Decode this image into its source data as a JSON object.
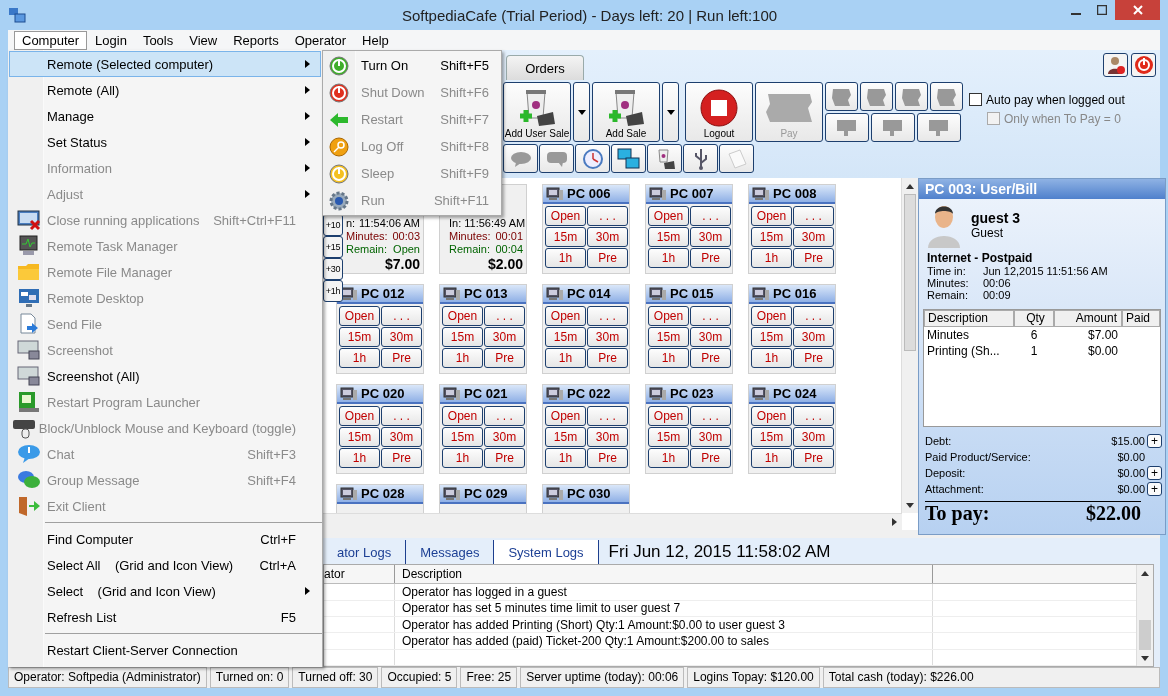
{
  "window": {
    "title": "SoftpediaCafe (Trial Period) - Days left: 20 | Run left:100"
  },
  "menu_bar": [
    {
      "label": "Computer",
      "selected": true
    },
    {
      "label": "Login",
      "selected": false
    },
    {
      "label": "Tools",
      "selected": false
    },
    {
      "label": "View",
      "selected": false
    },
    {
      "label": "Reports",
      "selected": false
    },
    {
      "label": "Operator",
      "selected": false
    },
    {
      "label": "Help",
      "selected": false
    }
  ],
  "computer_menu": [
    {
      "kind": "item",
      "label": "Remote (Selected computer)",
      "submenu": true,
      "disabled": false,
      "selected": true
    },
    {
      "kind": "item",
      "label": "Remote (All)",
      "submenu": true,
      "disabled": false,
      "selected": false
    },
    {
      "kind": "item",
      "label": "Manage",
      "submenu": true,
      "disabled": false,
      "selected": false
    },
    {
      "kind": "item",
      "label": "Set Status",
      "submenu": true,
      "disabled": false,
      "selected": false
    },
    {
      "kind": "item",
      "label": "Information",
      "submenu": true,
      "disabled": true,
      "selected": false
    },
    {
      "kind": "item",
      "label": "Adjust",
      "submenu": true,
      "disabled": true,
      "selected": false
    },
    {
      "kind": "item",
      "label": "Close running applications",
      "shortcut": "Shift+Ctrl+F11",
      "submenu": false,
      "disabled": true,
      "selected": false
    },
    {
      "kind": "item",
      "label": "Remote Task Manager",
      "submenu": false,
      "disabled": true,
      "selected": false
    },
    {
      "kind": "item",
      "label": "Remote File Manager",
      "submenu": false,
      "disabled": true,
      "selected": false
    },
    {
      "kind": "item",
      "label": "Remote Desktop",
      "submenu": false,
      "disabled": true,
      "selected": false
    },
    {
      "kind": "item",
      "label": "Send File",
      "submenu": false,
      "disabled": true,
      "selected": false
    },
    {
      "kind": "item",
      "label": "Screenshot",
      "submenu": false,
      "disabled": true,
      "selected": false
    },
    {
      "kind": "item",
      "label": "Screenshot (All)",
      "submenu": false,
      "disabled": false,
      "selected": false
    },
    {
      "kind": "item",
      "label": "Restart Program Launcher",
      "submenu": false,
      "disabled": true,
      "selected": false
    },
    {
      "kind": "item",
      "label": "Block/Unblock Mouse and Keyboard (toggle)",
      "submenu": false,
      "disabled": true,
      "selected": false
    },
    {
      "kind": "item",
      "label": "Chat",
      "shortcut": "Shift+F3",
      "submenu": false,
      "disabled": true,
      "selected": false
    },
    {
      "kind": "item",
      "label": "Group Message",
      "shortcut": "Shift+F4",
      "submenu": false,
      "disabled": true,
      "selected": false
    },
    {
      "kind": "item",
      "label": "Exit Client",
      "submenu": false,
      "disabled": true,
      "selected": false
    },
    {
      "kind": "separator"
    },
    {
      "kind": "item",
      "label": "Find Computer",
      "shortcut": "Ctrl+F",
      "submenu": false,
      "disabled": false,
      "selected": false
    },
    {
      "kind": "item",
      "label": "Select All    (Grid and Icon View)",
      "shortcut": "Ctrl+A",
      "submenu": false,
      "disabled": false,
      "selected": false
    },
    {
      "kind": "item",
      "label": "Select    (Grid and Icon View)",
      "submenu": true,
      "disabled": false,
      "selected": false
    },
    {
      "kind": "item",
      "label": "Refresh List",
      "shortcut": "F5",
      "submenu": false,
      "disabled": false,
      "selected": false
    },
    {
      "kind": "separator"
    },
    {
      "kind": "item",
      "label": "Restart Client-Server Connection",
      "submenu": false,
      "disabled": false,
      "selected": false
    }
  ],
  "remote_submenu": [
    {
      "label": "Turn On",
      "shortcut": "Shift+F5",
      "disabled": false
    },
    {
      "label": "Shut Down",
      "shortcut": "Shift+F6",
      "disabled": true
    },
    {
      "label": "Restart",
      "shortcut": "Shift+F7",
      "disabled": true
    },
    {
      "label": "Log Off",
      "shortcut": "Shift+F8",
      "disabled": true
    },
    {
      "label": "Sleep",
      "shortcut": "Shift+F9",
      "disabled": true
    },
    {
      "label": "Run",
      "shortcut": "Shift+F11",
      "disabled": true
    }
  ],
  "tabs": [
    {
      "label": "Orders"
    }
  ],
  "toolbar": [
    {
      "label": "Add User Sale",
      "dropdown": true,
      "disabled": false
    },
    {
      "label": "Add Sale",
      "dropdown": true,
      "disabled": false
    },
    {
      "label": "Logout",
      "dropdown": false,
      "disabled": false
    },
    {
      "label": "Pay",
      "dropdown": false,
      "disabled": true
    }
  ],
  "options": [
    {
      "label": "Auto pay when logged out",
      "checked": false,
      "disabled": false
    },
    {
      "label": "Only when To Pay = 0",
      "checked": false,
      "disabled": true
    }
  ],
  "pc_grid": {
    "time_buttons": [
      "+10",
      "+15",
      "+30",
      "+1h"
    ],
    "rows": [
      [
        {
          "kind": "session",
          "lines": [
            {
              "label": "n:",
              "value": "11:54:06 AM"
            },
            {
              "label": "Minutes:",
              "value": "00:03"
            },
            {
              "label": "Remain:",
              "value": "Open"
            }
          ],
          "amount": "$7.00"
        },
        {
          "kind": "session",
          "lines": [
            {
              "label": "In:",
              "value": "11:56:49 AM"
            },
            {
              "label": "Minutes:",
              "value": "00:01"
            },
            {
              "label": "Remain:",
              "value": "00:04"
            }
          ],
          "amount": "$2.00"
        },
        {
          "kind": "free",
          "name": "PC 006",
          "buttons": [
            "Open",
            ". . .",
            "15m",
            "30m",
            "1h",
            "Pre"
          ]
        },
        {
          "kind": "free",
          "name": "PC 007",
          "buttons": [
            "Open",
            ". . .",
            "15m",
            "30m",
            "1h",
            "Pre"
          ]
        },
        {
          "kind": "free",
          "name": "PC 008",
          "buttons": [
            "Open",
            ". . .",
            "15m",
            "30m",
            "1h",
            "Pre"
          ]
        }
      ],
      [
        {
          "kind": "free",
          "name": "PC 012",
          "buttons": [
            "Open",
            ". . .",
            "15m",
            "30m",
            "1h",
            "Pre"
          ]
        },
        {
          "kind": "free",
          "name": "PC 013",
          "buttons": [
            "Open",
            ". . .",
            "15m",
            "30m",
            "1h",
            "Pre"
          ]
        },
        {
          "kind": "free",
          "name": "PC 014",
          "buttons": [
            "Open",
            ". . .",
            "15m",
            "30m",
            "1h",
            "Pre"
          ]
        },
        {
          "kind": "free",
          "name": "PC 015",
          "buttons": [
            "Open",
            ". . .",
            "15m",
            "30m",
            "1h",
            "Pre"
          ]
        },
        {
          "kind": "free",
          "name": "PC 016",
          "buttons": [
            "Open",
            ". . .",
            "15m",
            "30m",
            "1h",
            "Pre"
          ]
        }
      ],
      [
        {
          "kind": "free",
          "name": "PC 020",
          "buttons": [
            "Open",
            ". . .",
            "15m",
            "30m",
            "1h",
            "Pre"
          ]
        },
        {
          "kind": "free",
          "name": "PC 021",
          "buttons": [
            "Open",
            ". . .",
            "15m",
            "30m",
            "1h",
            "Pre"
          ]
        },
        {
          "kind": "free",
          "name": "PC 022",
          "buttons": [
            "Open",
            ". . .",
            "15m",
            "30m",
            "1h",
            "Pre"
          ]
        },
        {
          "kind": "free",
          "name": "PC 023",
          "buttons": [
            "Open",
            ". . .",
            "15m",
            "30m",
            "1h",
            "Pre"
          ]
        },
        {
          "kind": "free",
          "name": "PC 024",
          "buttons": [
            "Open",
            ". . .",
            "15m",
            "30m",
            "1h",
            "Pre"
          ]
        }
      ],
      [
        {
          "kind": "free",
          "name": "PC 028"
        },
        {
          "kind": "free",
          "name": "PC 029"
        },
        {
          "kind": "free",
          "name": "PC 030"
        }
      ]
    ]
  },
  "bill": {
    "title": "PC 003: User/Bill",
    "user": {
      "name": "guest 3",
      "role": "Guest"
    },
    "plan": "Internet - Postpaid",
    "details": [
      {
        "label": "Time in:",
        "value": "Jun 12,2015 11:51:56 AM"
      },
      {
        "label": "Minutes:",
        "value": "00:06"
      },
      {
        "label": "Remain:",
        "value": "00:09"
      }
    ],
    "columns": [
      "Description",
      "Qty",
      "Amount",
      "Paid"
    ],
    "rows": [
      {
        "description": "Minutes",
        "qty": "6",
        "amount": "$7.00"
      },
      {
        "description": "Printing (Sh...",
        "qty": "1",
        "amount": "$0.00"
      }
    ],
    "totals": [
      {
        "label": "Debt:",
        "value": "$15.00",
        "button": "+"
      },
      {
        "label": "Paid Product/Service:",
        "value": "$0.00"
      },
      {
        "label": "Deposit:",
        "value": "$0.00",
        "button": "+"
      },
      {
        "label": "Attachment:",
        "value": "$0.00",
        "button": "+"
      }
    ],
    "to_pay": {
      "label": "To pay:",
      "value": "$22.00"
    }
  },
  "logs": {
    "tabs": [
      {
        "label": "ator Logs",
        "selected": false
      },
      {
        "label": "Messages",
        "selected": false
      },
      {
        "label": "System Logs",
        "selected": true
      }
    ],
    "clock": "Fri Jun 12, 2015  11:58:02 AM",
    "columns": [
      "ator",
      "Description"
    ],
    "rows": [
      "Operator has logged in a guest",
      "Operator has set 5 minutes time limit to user guest 7",
      "Operator has added Printing (Short) Qty:1 Amount:$0.00 to user guest 3",
      "Operator has added (paid) Ticket-200 Qty:1 Amount:$200.00 to sales"
    ]
  },
  "status_bar": [
    "Operator: Softpedia (Administrator)",
    "Turned on: 0",
    "Turned off: 30",
    "Occupied: 5",
    "Free: 25",
    "Server uptime (today): 00:06",
    "Logins Topay: $120.00",
    "Total cash (today): $226.00"
  ]
}
